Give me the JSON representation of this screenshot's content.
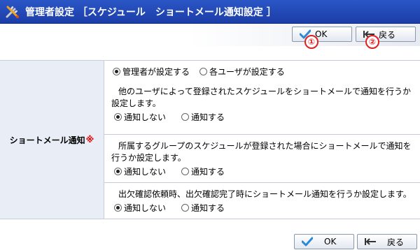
{
  "window": {
    "title": "管理者設定 ［スケジュール　ショートメール通知設定 ］"
  },
  "toolbar": {
    "ok_label": "OK",
    "back_label": "戻る",
    "badge_ok": "①",
    "badge_back": "②"
  },
  "form": {
    "field_label": "ショートメール通知",
    "required_mark": "※",
    "setter": {
      "options": [
        "管理者が設定する",
        "各ユーザが設定する"
      ],
      "selected": 0
    },
    "sections": [
      {
        "description_line1": "他のユーザによって登録されたスケジュールをショートメールで通知を行うか",
        "description_line2": "設定します。",
        "options": [
          "通知しない",
          "通知する"
        ],
        "selected": 0
      },
      {
        "description_line1": "所属するグループのスケジュールが登録された場合にショートメールで通知を",
        "description_line2": "行うか設定します。",
        "options": [
          "通知しない",
          "通知する"
        ],
        "selected": 0
      },
      {
        "description_line1": "出欠確認依頼時、出欠確認完了時にショートメール通知を行うか設定します。",
        "options": [
          "通知しない",
          "通知する"
        ],
        "selected": 0
      }
    ]
  },
  "colors": {
    "title_bar": "#1c3da8",
    "label_cell": "#e8edf6",
    "badge": "#e02020"
  }
}
